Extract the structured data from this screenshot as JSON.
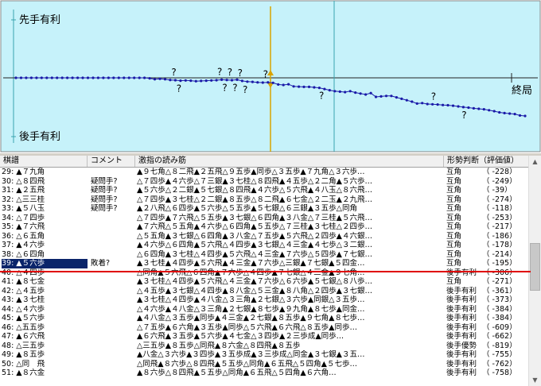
{
  "graph": {
    "label_sente": "先手有利",
    "label_gote": "後手有利",
    "label_end": "終局",
    "question_mark": "?",
    "colors": {
      "background": "#c6f2fa",
      "line": "#1a1aa8",
      "cursor": "#d9a400",
      "grid": "#3aa4b0"
    }
  },
  "table": {
    "headers": {
      "move": "棋譜",
      "comment": "コメント",
      "reading": "激指の読み筋",
      "judgement": "形勢判断（評価値）"
    },
    "rows": [
      {
        "move": "29: ▲７九角",
        "comment": "",
        "reading": "▲９七角△８二飛▲２五飛△９五歩▲同歩△３五歩▲７九角△３六歩…",
        "judge": "互角",
        "score": "（ -228）"
      },
      {
        "move": "30: △８四飛",
        "comment": "疑問手?",
        "reading": "△７四歩▲４六歩△７三銀▲３七桂△８四飛▲４五歩△２二角▲５六歩…",
        "judge": "互角",
        "score": "（ -249）"
      },
      {
        "move": "31: ▲２五飛",
        "comment": "疑問手?",
        "reading": "▲５六歩△２二銀▲５七銀△８四飛▲４六歩△５六飛▲４八玉△８六飛…",
        "judge": "互角",
        "score": "（ -39）"
      },
      {
        "move": "32: △三三桂",
        "comment": "疑問手?",
        "reading": "△７四歩▲３七桂△２二銀▲８五歩△８二飛▲６七金△２二玉▲２九飛…",
        "judge": "互角",
        "score": "（ -274）"
      },
      {
        "move": "33: ▲５八玉",
        "comment": "疑問手?",
        "reading": "▲２八飛△６四歩▲５六歩△５五歩▲５七銀△６三銀▲３五歩△同角",
        "judge": "互角",
        "score": "（ -118）"
      },
      {
        "move": "34: △７四歩",
        "comment": "",
        "reading": "△７四歩▲７六飛△５五歩▲３七銀△６四角▲３八金△７三桂▲５六飛…",
        "judge": "互角",
        "score": "（ -253）"
      },
      {
        "move": "35: ▲７六飛",
        "comment": "",
        "reading": "▲７六飛△５五角▲４六歩△６四角▲５五歩△７三桂▲３七桂△２四歩…",
        "judge": "互角",
        "score": "（ -217）"
      },
      {
        "move": "36: △６五角",
        "comment": "",
        "reading": "△５五角▲３七銀△６四角▲３八金△７五歩▲５六飛△２四歩▲４六銀…",
        "judge": "互角",
        "score": "（ -186）"
      },
      {
        "move": "37: ▲４六歩",
        "comment": "",
        "reading": "▲４六歩△６四角▲５六飛△４四歩▲３七銀△４三金▲４七歩△３二銀…",
        "judge": "互角",
        "score": "（ -178）"
      },
      {
        "move": "38: △６四角",
        "comment": "",
        "reading": "△６四角▲３七桂△４四歩▲５六飛△４三金▲７六歩△５四歩▲７七銀…",
        "judge": "互角",
        "score": "（ -214）"
      },
      {
        "move": "39: ▲５六歩",
        "comment": "敗着?",
        "reading": "▲３七桂▲４四歩▲５六飛▲４三金▲７六歩△三銀▲７七銀▲５四金…",
        "judge": "互角",
        "score": "（ -195）"
      },
      {
        "move": "40: △４四歩",
        "comment": "",
        "reading": "△同角▲５六飛△６四角▲７六歩△４四歩▲７七銀△４三金▲９七角…",
        "judge": "後手有利",
        "score": "（ -306）"
      },
      {
        "move": "41: ▲８七金",
        "comment": "",
        "reading": "▲３七桂△４四歩▲５六飛△４三金▲７六歩△６六歩▲５七銀△８八歩…",
        "judge": "互角",
        "score": "（ -271）"
      },
      {
        "move": "42: △４五歩",
        "comment": "",
        "reading": "△４五歩▲３七銀△４四歩▲８八金△５三金▲８八角△２四歩▲３七銀…",
        "judge": "後手有利",
        "score": "（ -361）"
      },
      {
        "move": "43: ▲３七桂",
        "comment": "",
        "reading": "▲３七桂△４四歩▲４八金△３三角▲２七銀△３六歩▲同銀△３五歩…",
        "judge": "後手有利",
        "score": "（ -373）"
      },
      {
        "move": "44: △４六歩",
        "comment": "",
        "reading": "△４六歩▲４八金△３三角▲２七銀▲８七歩▲９九角▲８七歩▲同金…",
        "judge": "後手有利",
        "score": "（ -384）"
      },
      {
        "move": "45: ▲５六歩",
        "comment": "",
        "reading": "▲４八金△３五歩▲同歩▲４三金▲２七銀▲８五歩▲９七角▲８七歩…",
        "judge": "後手有利",
        "score": "（ -384）"
      },
      {
        "move": "46: △五五歩",
        "comment": "",
        "reading": "△７五歩▲６六角▲３五歩▲同歩△５六飛▲６六飛△８五歩▲同歩…",
        "judge": "後手有利",
        "score": "（ -609）"
      },
      {
        "move": "47: ▲６六飛",
        "comment": "",
        "reading": "▲６六飛▲３五歩▲５六歩▲４七金△３四歩▲２三歩成▲同歩…",
        "judge": "後手有利",
        "score": "（ -662）"
      },
      {
        "move": "48: △三五歩",
        "comment": "",
        "reading": "△三五歩▲８五歩△同飛▲８六金△８四飛▲８五歩",
        "judge": "後手優勢",
        "score": "（ -819）"
      },
      {
        "move": "49: ▲８五歩",
        "comment": "",
        "reading": "▲八金△３六歩▲３四歩▲３五歩成▲３三歩成△同金▲３七銀▲３五…",
        "judge": "後手有利",
        "score": "（ -755）"
      },
      {
        "move": "50: △同　飛",
        "comment": "",
        "reading": "△同飛▲８六歩△８四飛▲５五歩△同角▲６五飛△５四角▲５七歩…",
        "judge": "後手有利",
        "score": "（ -762）"
      },
      {
        "move": "51: ▲８六金",
        "comment": "",
        "reading": "▲８六歩△８四飛▲５五歩△同角▲６五飛△５四角▲６六角…",
        "judge": "後手有利",
        "score": "（ -758）"
      }
    ]
  },
  "chart_data": {
    "type": "line",
    "title": "",
    "xlabel": "",
    "ylabel": "",
    "x_range": [
      0,
      100
    ],
    "ylim": [
      -2000,
      2000
    ],
    "markers": [
      "●",
      "●"
    ],
    "question_marks_x": [
      31,
      32,
      40,
      41,
      42,
      43,
      44,
      45,
      49,
      60,
      82,
      88
    ],
    "cursor_x": 50,
    "grid": true,
    "series": [
      {
        "name": "",
        "y": [
          0,
          0,
          0,
          0,
          0,
          0,
          0,
          0,
          0,
          0,
          0,
          0,
          0,
          0,
          0,
          0,
          0,
          0,
          0,
          0,
          0,
          0,
          0,
          0,
          0,
          0,
          -20,
          -60,
          -40,
          -60,
          -90,
          -100,
          -120,
          -110,
          -120,
          -140,
          -130,
          -120,
          -110,
          -100,
          -80,
          -90,
          -100,
          -80,
          -130,
          -160,
          -170,
          -190,
          -200,
          -190,
          -210,
          -280,
          -300,
          -270,
          -360,
          -370,
          -380,
          -380,
          -400,
          -420,
          -470,
          -520,
          -560,
          -580,
          -600,
          -560,
          -620,
          -660,
          -700,
          -640,
          -800,
          -780,
          -760,
          -760,
          -820,
          -880,
          -940,
          -1000,
          -1080,
          -1060,
          -1100,
          -1110,
          -1120,
          -1140,
          -1150,
          -1170,
          -1200,
          -1230,
          -1250,
          -1280,
          -1300,
          -1320,
          -1360,
          -1400,
          -1450,
          -1480,
          -1500,
          -1520,
          -1580,
          -1600
        ]
      }
    ]
  }
}
